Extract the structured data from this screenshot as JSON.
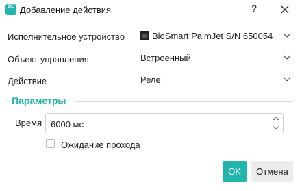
{
  "window": {
    "title": "Добавление действия",
    "app_icon_text": "BIO",
    "help_label": "?",
    "colors": {
      "accent": "#22b5ab",
      "ok_text": "#ffffff",
      "cancel_bg": "#ececec"
    }
  },
  "form": {
    "device": {
      "label": "Исполнительное устройство",
      "value": "BioSmart PalmJet S/N 650054",
      "icon": "device-icon"
    },
    "control_object": {
      "label": "Объект управления",
      "value": "Встроенный"
    },
    "action": {
      "label": "Действие",
      "value": "Реле"
    }
  },
  "parameters": {
    "section_title": "Параметры",
    "time": {
      "label": "Время",
      "value": "6000 мс"
    },
    "wait_pass": {
      "label": "Ожидание прохода",
      "checked": false
    }
  },
  "buttons": {
    "ok": "OK",
    "cancel": "Отмена"
  }
}
